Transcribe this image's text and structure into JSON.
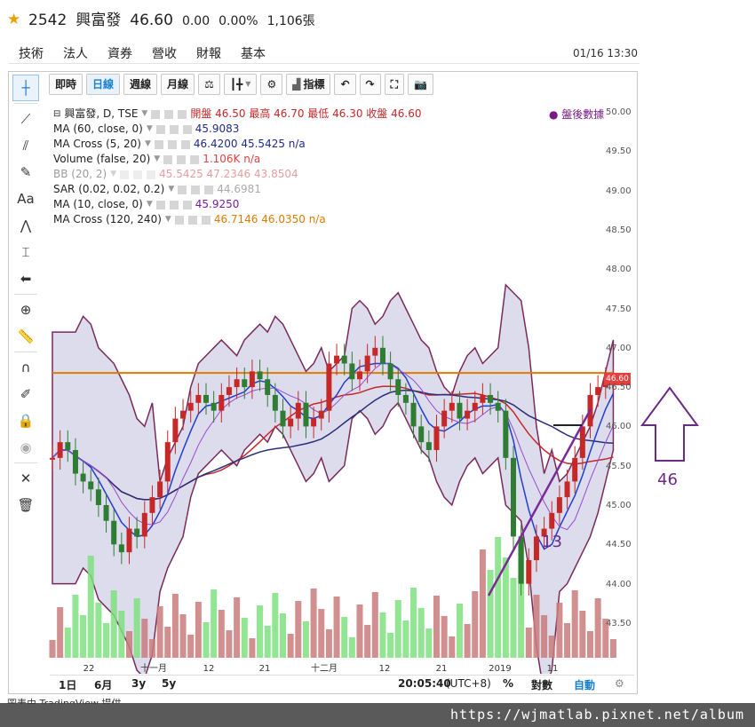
{
  "header": {
    "ticker": "2542",
    "name": "興富發",
    "price": "46.60",
    "change": "0.00",
    "change_pct": "0.00%",
    "volume": "1,106張"
  },
  "tabs": [
    "技術",
    "法人",
    "資券",
    "營收",
    "財報",
    "基本"
  ],
  "timestamp": "01/16 13:30",
  "toolbar": {
    "intraday": "即時",
    "daily": "日線",
    "weekly": "週線",
    "monthly": "月線",
    "indicators": "指標"
  },
  "legend": {
    "symbol": "興富發, D, TSE",
    "ohlc": "開盤 46.50 最高 46.70 最低 46.30 收盤 46.60",
    "after_hours": "盤後數據",
    "rows": [
      {
        "label": "MA (60, close, 0)",
        "values": "45.9083",
        "color": "#1f2a8a"
      },
      {
        "label": "MA Cross (5, 20)",
        "values": "46.4200 45.5425 n/a",
        "color": "#1f2a8a"
      },
      {
        "label": "Volume (false, 20)",
        "values": "1.106K n/a",
        "color": "#e34040"
      },
      {
        "label": "BB (20, 2)",
        "values": "45.5425 47.2346 43.8504",
        "color": "#c62828"
      },
      {
        "label": "SAR (0.02, 0.02, 0.2)",
        "values": "44.6981",
        "color": "#aaa"
      },
      {
        "label": "MA (10, close, 0)",
        "values": "45.9250",
        "color": "#7a1aa0"
      },
      {
        "label": "MA Cross (120, 240)",
        "values": "46.7146 46.0350 n/a",
        "color": "#e07b00"
      }
    ]
  },
  "price_axis": [
    "50.00",
    "49.50",
    "49.00",
    "48.50",
    "48.00",
    "47.50",
    "47.00",
    "46.50",
    "46.00",
    "45.50",
    "45.00",
    "44.50",
    "44.00",
    "43.50"
  ],
  "current_price_tag": "46.60",
  "x_labels": [
    "22",
    "十一月",
    "12",
    "21",
    "十二月",
    "12",
    "21",
    "2019",
    "11"
  ],
  "bottom": {
    "ranges": [
      "1日",
      "6月",
      "3y",
      "5y"
    ],
    "clock": "20:05:40",
    "tz": "(UTC+8)",
    "pct": "%",
    "log": "對數",
    "auto": "自動"
  },
  "annotations": {
    "level": "46",
    "count": "13"
  },
  "footer": {
    "left": "圖表由 TradingView 提供",
    "url": "https://wjmatlab.pixnet.net/album"
  },
  "colors": {
    "up": "#c62828",
    "down": "#2e7d32",
    "vol_up": "#c97b7b",
    "vol_down": "#7fe07f",
    "annotation": "#6a2a86"
  }
}
